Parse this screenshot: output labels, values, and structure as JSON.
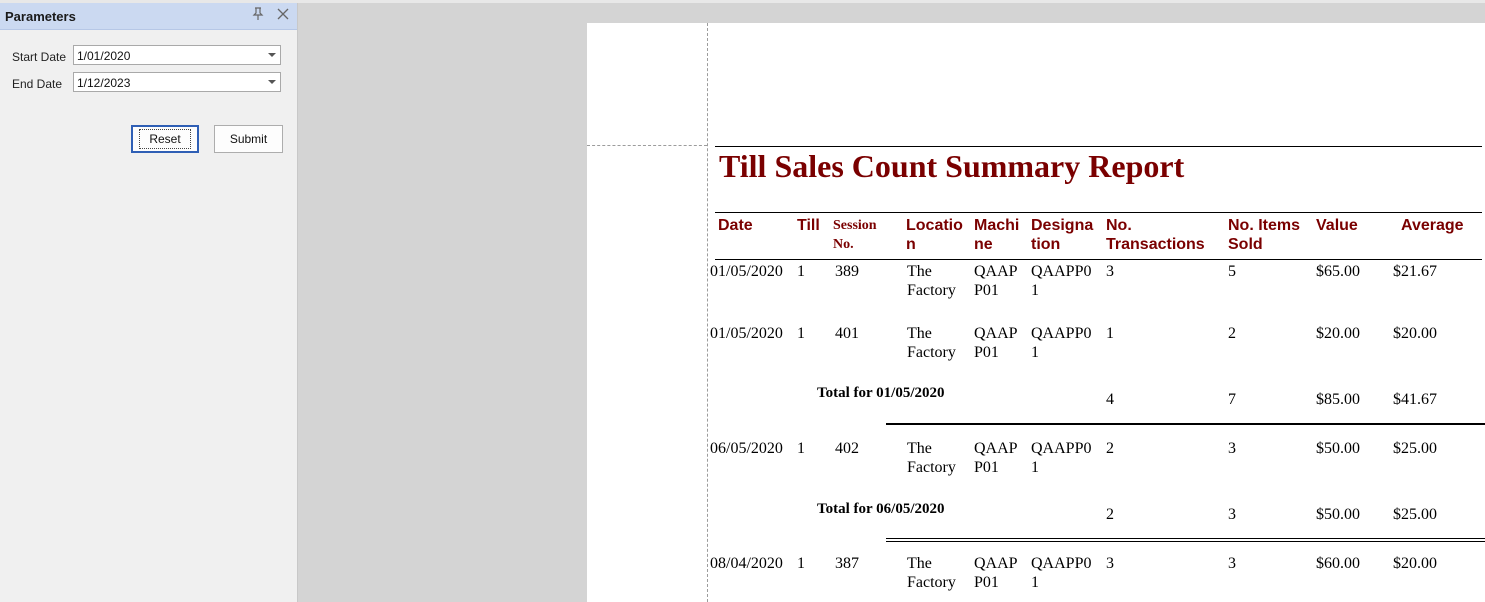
{
  "parameters": {
    "title": "Parameters",
    "pin_icon": "pin-icon",
    "close_icon": "close-icon",
    "start_label": "Start Date",
    "start_value": "1/01/2020",
    "end_label": "End Date",
    "end_value": "1/12/2023",
    "reset_label": "Reset",
    "submit_label": "Submit"
  },
  "report": {
    "title": "Till Sales Count Summary Report",
    "headers": {
      "date": "Date",
      "till": "Till",
      "session_1": "Session",
      "session_2": "No.",
      "location_1": "Locatio",
      "location_2": "n",
      "machine_1": "Machi",
      "machine_2": "ne",
      "designation_1": "Designa",
      "designation_2": "tion",
      "transactions_1": "No.",
      "transactions_2": "Transactions",
      "items_1": "No. Items",
      "items_2": "Sold",
      "value": "Value",
      "average": "Average"
    },
    "rows": [
      {
        "date": "01/05/2020",
        "till": "1",
        "session": "389",
        "location_1": "The",
        "location_2": "Factory",
        "machine_1": "QAAP",
        "machine_2": "P01",
        "designation_1": "QAAPP0",
        "designation_2": "1",
        "transactions": "3",
        "items": "5",
        "value": "$65.00",
        "average": "$21.67"
      },
      {
        "date": "01/05/2020",
        "till": "1",
        "session": "401",
        "location_1": "The",
        "location_2": "Factory",
        "machine_1": "QAAP",
        "machine_2": "P01",
        "designation_1": "QAAPP0",
        "designation_2": "1",
        "transactions": "1",
        "items": "2",
        "value": "$20.00",
        "average": "$20.00"
      },
      {
        "date": "06/05/2020",
        "till": "1",
        "session": "402",
        "location_1": "The",
        "location_2": "Factory",
        "machine_1": "QAAP",
        "machine_2": "P01",
        "designation_1": "QAAPP0",
        "designation_2": "1",
        "transactions": "2",
        "items": "3",
        "value": "$50.00",
        "average": "$25.00"
      },
      {
        "date": "08/04/2020",
        "till": "1",
        "session": "387",
        "location_1": "The",
        "location_2": "Factory",
        "machine_1": "QAAP",
        "machine_2": "P01",
        "designation_1": "QAAPP0",
        "designation_2": "1",
        "transactions": "3",
        "items": "3",
        "value": "$60.00",
        "average": "$20.00"
      }
    ],
    "totals": [
      {
        "label": "Total for 01/05/2020",
        "transactions": "4",
        "items": "7",
        "value": "$85.00",
        "average": "$41.67"
      },
      {
        "label": "Total for 06/05/2020",
        "transactions": "2",
        "items": "3",
        "value": "$50.00",
        "average": "$25.00"
      }
    ]
  }
}
